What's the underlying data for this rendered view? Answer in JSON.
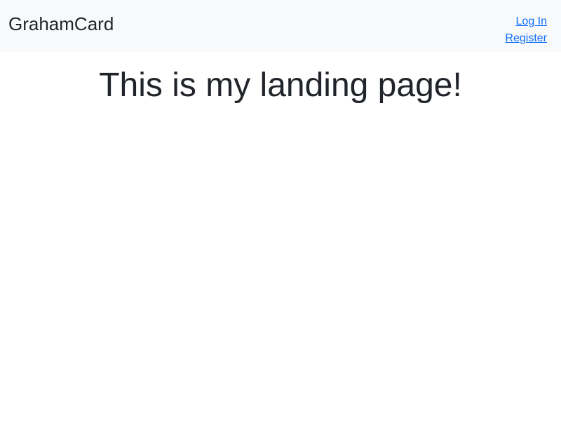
{
  "navbar": {
    "brand": "GrahamCard",
    "links": [
      {
        "label": "Log In"
      },
      {
        "label": "Register"
      }
    ]
  },
  "main": {
    "heading": "This is my landing page!"
  },
  "colors": {
    "navbar_bg": "#f8f9fa",
    "link": "#0d6efd",
    "text": "#212529"
  }
}
